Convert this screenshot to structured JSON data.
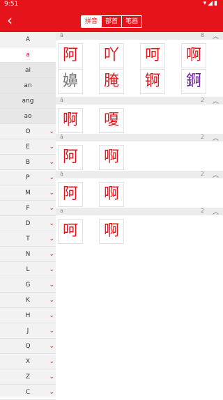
{
  "status": {
    "time": "9:51",
    "icons": "▾◢▮"
  },
  "appbar": {
    "back_icon": "‹",
    "tabs": [
      "拼音",
      "部首",
      "笔画"
    ]
  },
  "colors": {
    "accent": "#e5141b",
    "gray_char": "#777777",
    "purple_char": "#6a1b9a"
  },
  "sidebar": [
    {
      "label": "A",
      "type": "header"
    },
    {
      "label": "a",
      "type": "selected"
    },
    {
      "label": "ai",
      "type": "sub"
    },
    {
      "label": "an",
      "type": "sub"
    },
    {
      "label": "ang",
      "type": "sub"
    },
    {
      "label": "ao",
      "type": "sub"
    },
    {
      "label": "O"
    },
    {
      "label": "E"
    },
    {
      "label": "B"
    },
    {
      "label": "P"
    },
    {
      "label": "M"
    },
    {
      "label": "F"
    },
    {
      "label": "D"
    },
    {
      "label": "T"
    },
    {
      "label": "N"
    },
    {
      "label": "L"
    },
    {
      "label": "G"
    },
    {
      "label": "K"
    },
    {
      "label": "H"
    },
    {
      "label": "J"
    },
    {
      "label": "Q"
    },
    {
      "label": "X"
    },
    {
      "label": "Z"
    },
    {
      "label": "C"
    }
  ],
  "chevron": "⌄",
  "sections": [
    {
      "pinyin": "ā",
      "count": "8",
      "chars": [
        "阿",
        "吖",
        "呵",
        "啊",
        "嬶",
        "腌",
        "锕",
        "錒"
      ],
      "colors": [
        "r",
        "r",
        "r",
        "r",
        "g",
        "r",
        "r",
        "p"
      ]
    },
    {
      "pinyin": "á",
      "count": "2",
      "chars": [
        "啊",
        "嗄"
      ],
      "colors": [
        "r",
        "r"
      ]
    },
    {
      "pinyin": "ǎ",
      "count": "2",
      "chars": [
        "阿",
        "啊"
      ],
      "colors": [
        "r",
        "r"
      ]
    },
    {
      "pinyin": "à",
      "count": "2",
      "chars": [
        "阿",
        "啊"
      ],
      "colors": [
        "r",
        "r"
      ]
    },
    {
      "pinyin": "a",
      "count": "2",
      "chars": [
        "呵",
        "啊"
      ],
      "colors": [
        "r",
        "r"
      ]
    }
  ],
  "up_icon": "︿"
}
